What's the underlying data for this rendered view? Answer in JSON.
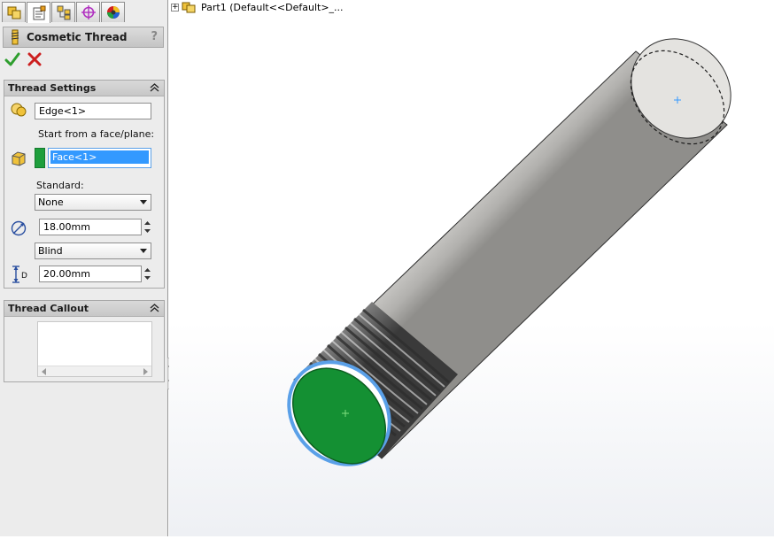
{
  "tree": {
    "expand_symbol": "+",
    "part_label": "Part1  (Default<<Default>_..."
  },
  "tabs": [
    {
      "icon": "feature-manager-icon"
    },
    {
      "icon": "property-manager-icon"
    },
    {
      "icon": "configuration-manager-icon"
    },
    {
      "icon": "dimxpert-manager-icon"
    },
    {
      "icon": "display-manager-icon"
    }
  ],
  "property_manager": {
    "title": "Cosmetic Thread",
    "help_symbol": "?"
  },
  "thread_settings": {
    "header": "Thread Settings",
    "edge_value": "Edge<1>",
    "start_label": "Start from a face/plane:",
    "face_value": "Face<1>",
    "standard_label": "Standard:",
    "standard_value": "None",
    "diameter_value": "18.00mm",
    "end_condition_value": "Blind",
    "depth_value": "20.00mm",
    "depth_icon_letter": "D"
  },
  "thread_callout": {
    "header": "Thread Callout"
  },
  "colors": {
    "face_selected": "#1e9e3c",
    "accent_blue": "#3399ff",
    "selection_outline": "#5aa0e8"
  }
}
